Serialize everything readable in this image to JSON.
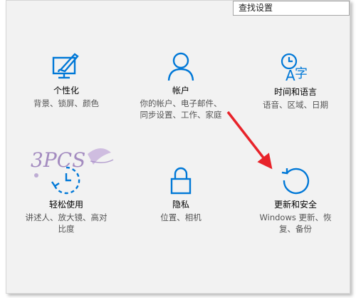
{
  "search": {
    "placeholder": "查找设置"
  },
  "tiles": [
    {
      "title": "个性化",
      "desc": [
        "背景、锁屏、颜色"
      ],
      "icon": "personalization-icon"
    },
    {
      "title": "帐户",
      "desc": [
        "你的帐户、电子邮件、",
        "同步设置、工作、家庭"
      ],
      "icon": "account-icon"
    },
    {
      "title": "时间和语言",
      "desc": [
        "语音、区域、日期"
      ],
      "icon": "time-language-icon"
    },
    {
      "title": "轻松使用",
      "desc": [
        "讲述人、放大镜、高对",
        "比度"
      ],
      "icon": "ease-of-access-icon"
    },
    {
      "title": "隐私",
      "desc": [
        "位置、相机"
      ],
      "icon": "privacy-lock-icon"
    },
    {
      "title": "更新和安全",
      "desc": [
        "Windows 更新、恢",
        "复、备份"
      ],
      "icon": "update-security-icon"
    }
  ],
  "watermark": {
    "text": "3PCSO"
  },
  "colors": {
    "accent": "#0078d7",
    "annotation_arrow": "#e8232a",
    "background": "#f2f2f2"
  }
}
